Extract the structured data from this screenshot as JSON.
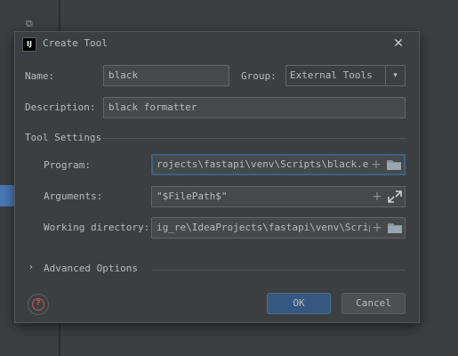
{
  "dialog": {
    "title": "Create Tool",
    "app_icon_text": "IJ",
    "close_glyph": "✕"
  },
  "form": {
    "name_label": "Name:",
    "name_value": "black",
    "group_label": "Group:",
    "group_value": "External Tools",
    "description_label": "Description:",
    "description_value": "black formatter"
  },
  "tool_settings": {
    "section_title": "Tool Settings",
    "program_label": "Program:",
    "program_value": "rojects\\fastapi\\venv\\Scripts\\black.exe",
    "arguments_label": "Arguments:",
    "arguments_value": "\"$FilePath$\"",
    "working_dir_label": "Working directory:",
    "working_dir_value": "ig_re\\IdeaProjects\\fastapi\\venv\\Scripts"
  },
  "advanced": {
    "label": "Advanced Options",
    "expanded": false
  },
  "buttons": {
    "ok_label": "OK",
    "cancel_label": "Cancel",
    "help_glyph": "?"
  },
  "icons": {
    "plus": "+",
    "folder": "folder-icon",
    "expand": "expand-icon",
    "chevron": "›",
    "combo_arrow": "▾"
  },
  "colors": {
    "accent": "#365880",
    "focus_border": "#3d6185",
    "help": "#c75450",
    "folder": "#87939a"
  }
}
